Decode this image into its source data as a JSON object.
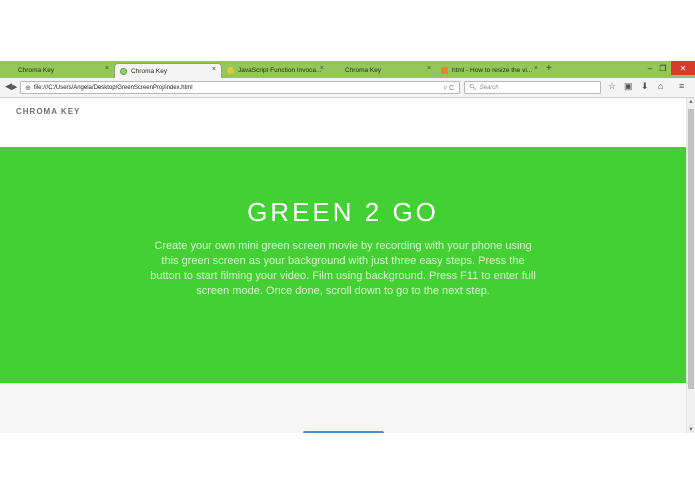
{
  "browser": {
    "tabs": [
      {
        "label": "Chroma Key",
        "close": "×",
        "active": false,
        "favicon": "none"
      },
      {
        "label": "Chroma Key",
        "close": "×",
        "active": true,
        "favicon": "green-circle-icon"
      },
      {
        "label": "JavaScript Function Invoca...",
        "close": "×",
        "active": false,
        "favicon": "js-icon"
      },
      {
        "label": "Chroma Key",
        "close": "×",
        "active": false,
        "favicon": "none"
      },
      {
        "label": "html - How to resize the vi...",
        "close": "×",
        "active": false,
        "favicon": "stackoverflow-icon"
      }
    ],
    "new_tab": "+",
    "window": {
      "minimize": "–",
      "maximize": "❐",
      "close": "✕"
    },
    "nav": {
      "back": "◀",
      "forward": "▶"
    },
    "url": "file:///C:/Users/Angela/Desktop/GreenScreenProj/index.html",
    "reload": "▿ C",
    "search_placeholder": "Search",
    "toolbar_icons": {
      "bookmark": "☆",
      "reading": "▣",
      "download": "⬇",
      "home": "⌂",
      "menu": "≡"
    },
    "colors": {
      "tabstrip": "#95c65a",
      "close": "#d43b2c"
    }
  },
  "page": {
    "brand": "CHROMA KEY",
    "hero": {
      "title": "GREEN 2 GO",
      "text": "Create your own mini green screen movie by recording with your phone using this green screen as your background with just three easy steps. Press the button to start filming your video. Film using background. Press F11 to enter full screen mode. Once done, scroll down to go to the next step.",
      "background": "#42d033"
    },
    "scrollbar": {
      "up": "▲",
      "down": "▼"
    }
  }
}
